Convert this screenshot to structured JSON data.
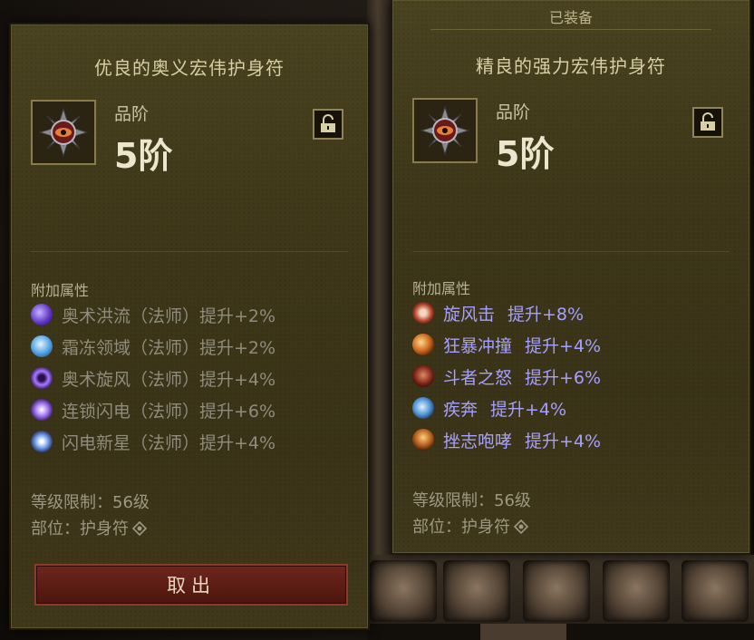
{
  "left_tooltip": {
    "title": "优良的奥义宏伟护身符",
    "item_icon": "amulet-icon",
    "grade_label": "品阶",
    "grade_value": "5阶",
    "lock_icon": "unlock-icon",
    "section_label": "附加属性",
    "affixes": [
      {
        "icon": "arcane-torrent-icon",
        "text": "奥术洪流（法师）提升+2%"
      },
      {
        "icon": "frost-domain-icon",
        "text": "霜冻领域（法师）提升+2%"
      },
      {
        "icon": "arcane-vortex-icon",
        "text": "奥术旋风（法师）提升+4%"
      },
      {
        "icon": "chain-lightning-icon",
        "text": "连锁闪电（法师）提升+6%"
      },
      {
        "icon": "lightning-nova-icon",
        "text": "闪电新星（法师）提升+4%"
      }
    ],
    "level_requirement": "等级限制：56级",
    "slot": "部位：护身符",
    "cancel_label": "取出"
  },
  "right_tooltip": {
    "equipped_label": "已装备",
    "title": "精良的强力宏伟护身符",
    "item_icon": "amulet-icon",
    "grade_label": "品阶",
    "grade_value": "5阶",
    "lock_icon": "unlock-icon",
    "section_label": "附加属性",
    "affixes": [
      {
        "icon": "whirlwind-icon",
        "name": "旋风击",
        "bonus": "提升+8%"
      },
      {
        "icon": "furious-charge-icon",
        "name": "狂暴冲撞",
        "bonus": "提升+4%"
      },
      {
        "icon": "wrath-of-the-berserker-icon",
        "name": "斗者之怒",
        "bonus": "提升+6%"
      },
      {
        "icon": "sprint-icon",
        "name": "疾奔",
        "bonus": "提升+4%"
      },
      {
        "icon": "demoralizing-shout-icon",
        "name": "挫志咆哮",
        "bonus": "提升+4%"
      }
    ],
    "level_requirement": "等级限制：56级",
    "slot": "部位：护身符"
  },
  "colors": {
    "panel": "#3e3719",
    "title": "#d8cfa4",
    "affix_inactive": "#8f8c7d",
    "affix_active": "#a4a0ff",
    "cancel_button": "#5c1d14"
  }
}
